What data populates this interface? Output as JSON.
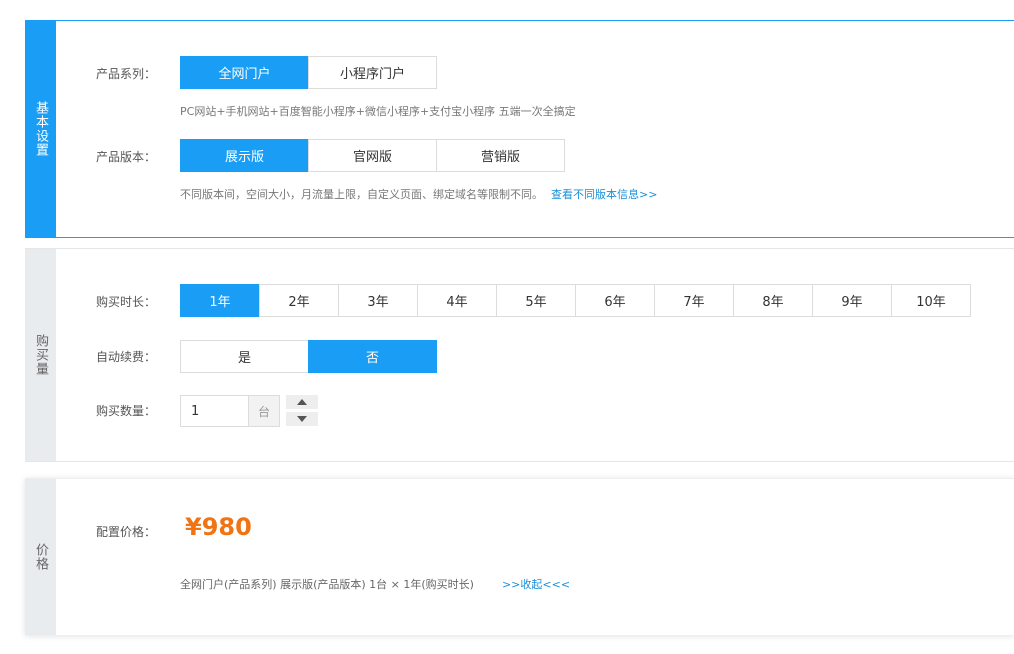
{
  "basic": {
    "side_label": "基本设置",
    "series_label": "产品系列：",
    "series_options": [
      "全网门户",
      "小程序门户"
    ],
    "series_hint": "PC网站+手机网站+百度智能小程序+微信小程序+支付宝小程序 五端一次全搞定",
    "version_label": "产品版本：",
    "version_options": [
      "展示版",
      "官网版",
      "营销版"
    ],
    "version_hint": "不同版本间，空间大小，月流量上限，自定义页面、绑定域名等限制不同。",
    "version_link": "查看不同版本信息>>"
  },
  "purchase": {
    "side_label": "购买量",
    "duration_label": "购买时长：",
    "duration_options": [
      "1年",
      "2年",
      "3年",
      "4年",
      "5年",
      "6年",
      "7年",
      "8年",
      "9年",
      "10年"
    ],
    "renew_label": "自动续费：",
    "renew_options": [
      "是",
      "否"
    ],
    "quantity_label": "购买数量：",
    "quantity_value": "1",
    "quantity_unit": "台"
  },
  "price": {
    "side_label": "价格",
    "config_label": "配置价格：",
    "amount": "¥980",
    "summary": "全网门户(产品系列)  展示版(产品版本)  1台 × 1年(购买时长)",
    "toggle": ">>收起<<<"
  },
  "icons": {
    "increment": "triangle-up-icon",
    "decrement": "triangle-down-icon"
  },
  "colors": {
    "accent": "#1a9ef5",
    "price": "#f07314",
    "link": "#1a8fd8"
  }
}
